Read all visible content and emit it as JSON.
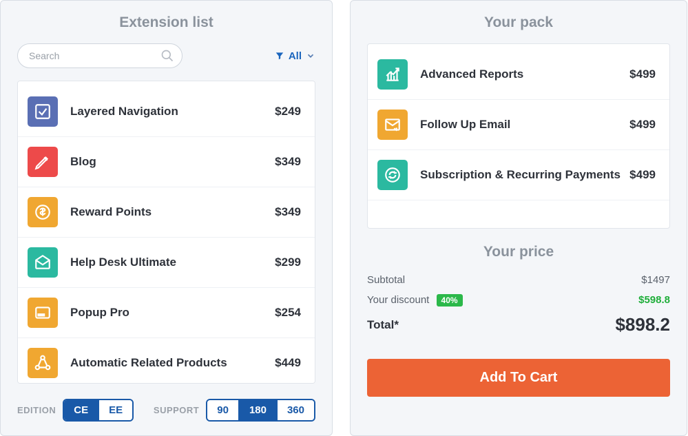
{
  "left": {
    "title": "Extension list",
    "search_placeholder": "Search",
    "filter_label": "All",
    "edition_label": "EDITION",
    "editions": [
      "CE",
      "EE"
    ],
    "edition_active": "CE",
    "support_label": "SUPPORT",
    "support_options": [
      "90",
      "180",
      "360"
    ],
    "support_active": "180",
    "extensions": [
      {
        "name": "Layered Navigation",
        "price": "$249",
        "icon": "check-box",
        "color": "bg-blue"
      },
      {
        "name": "Blog",
        "price": "$349",
        "icon": "pencil",
        "color": "bg-red"
      },
      {
        "name": "Reward Points",
        "price": "$349",
        "icon": "coin",
        "color": "bg-orange"
      },
      {
        "name": "Help Desk Ultimate",
        "price": "$299",
        "icon": "envelope-open",
        "color": "bg-teal"
      },
      {
        "name": "Popup Pro",
        "price": "$254",
        "icon": "window",
        "color": "bg-orange"
      },
      {
        "name": "Automatic Related Products",
        "price": "$449",
        "icon": "nodes",
        "color": "bg-orange"
      }
    ]
  },
  "right": {
    "title": "Your pack",
    "pack_items": [
      {
        "name": "Advanced Reports",
        "price": "$499",
        "icon": "chart",
        "color": "bg-teal"
      },
      {
        "name": "Follow Up Email",
        "price": "$499",
        "icon": "envelope-arrow",
        "color": "bg-orange"
      },
      {
        "name": "Subscription & Recurring Payments",
        "price": "$499",
        "icon": "calendar-refresh",
        "color": "bg-teal"
      }
    ],
    "price_title": "Your price",
    "subtotal_label": "Subtotal",
    "subtotal_value": "$1497",
    "discount_label": "Your discount",
    "discount_badge": "40%",
    "discount_value": "$598.8",
    "total_label": "Total*",
    "total_value": "$898.2",
    "add_to_cart": "Add To Cart"
  }
}
